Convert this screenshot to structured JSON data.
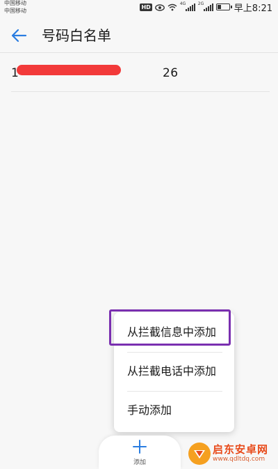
{
  "status_bar": {
    "carrier_1": "中国移动",
    "carrier_2": "中国移动",
    "hd": "HD",
    "net_1": "4G",
    "net_2": "2G",
    "time": "早上8:21"
  },
  "header": {
    "title": "号码白名单",
    "back_icon": "arrow-left-icon",
    "accent": "#2a7de1"
  },
  "whitelist": {
    "entries": [
      {
        "number": "1                                   26",
        "redacted": true
      }
    ]
  },
  "add_menu": {
    "items": [
      {
        "label": "从拦截信息中添加"
      },
      {
        "label": "从拦截电话中添加"
      },
      {
        "label": "手动添加"
      }
    ],
    "highlight_color": "#7a2fb0"
  },
  "bottom_bar": {
    "add_label": "添加",
    "add_icon": "plus-icon"
  },
  "watermark": {
    "name": "启东安卓网",
    "url": "www.qdltdq.com"
  }
}
